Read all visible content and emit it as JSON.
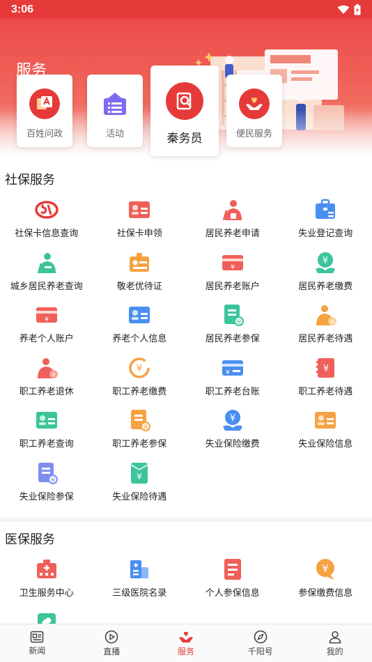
{
  "status": {
    "time": "3:06"
  },
  "header": {
    "title": "服务"
  },
  "quick_links": [
    {
      "label": "百姓问政",
      "icon": "petition-icon"
    },
    {
      "label": "活动",
      "icon": "activity-icon"
    },
    {
      "label": "秦务员",
      "icon": "search-doc-icon"
    },
    {
      "label": "便民服务",
      "icon": "heart-hands-icon"
    }
  ],
  "social": {
    "title": "社保服务",
    "items": [
      {
        "label": "社保卡信息查询",
        "icon": "social-security-logo-icon"
      },
      {
        "label": "社保卡申领",
        "icon": "id-card-icon"
      },
      {
        "label": "居民养老申请",
        "icon": "elderly-person-icon"
      },
      {
        "label": "失业登记查询",
        "icon": "briefcase-icon"
      },
      {
        "label": "城乡居民养老查询",
        "icon": "elderly-cane-icon"
      },
      {
        "label": "敬老优待证",
        "icon": "certificate-icon"
      },
      {
        "label": "居民养老账户",
        "icon": "bank-card-icon"
      },
      {
        "label": "居民养老缴费",
        "icon": "coin-hand-icon"
      },
      {
        "label": "养老个人账户",
        "icon": "card-account-icon"
      },
      {
        "label": "养老个人信息",
        "icon": "profile-card-icon"
      },
      {
        "label": "居民养老参保",
        "icon": "insurance-doc-icon"
      },
      {
        "label": "居民养老待遇",
        "icon": "elderly-benefit-icon"
      },
      {
        "label": "职工养老退休",
        "icon": "retire-person-icon"
      },
      {
        "label": "职工养老缴费",
        "icon": "yuan-refresh-icon"
      },
      {
        "label": "职工养老台账",
        "icon": "ledger-card-icon"
      },
      {
        "label": "职工养老待遇",
        "icon": "benefit-book-icon"
      },
      {
        "label": "职工养老查询",
        "icon": "staff-card-icon"
      },
      {
        "label": "职工养老参保",
        "icon": "staff-insure-doc-icon"
      },
      {
        "label": "失业保险缴费",
        "icon": "yuan-hand-icon"
      },
      {
        "label": "失业保险信息",
        "icon": "info-card-icon"
      },
      {
        "label": "失业保险参保",
        "icon": "unemploy-insure-doc-icon"
      },
      {
        "label": "失业保险待遇",
        "icon": "yuan-envelope-icon"
      }
    ]
  },
  "medical": {
    "title": "医保服务",
    "items": [
      {
        "label": "卫生服务中心",
        "icon": "clinic-icon"
      },
      {
        "label": "三级医院名录",
        "icon": "hospital-icon"
      },
      {
        "label": "个人参保信息",
        "icon": "document-icon"
      },
      {
        "label": "参保缴费信息",
        "icon": "yuan-bubble-icon"
      },
      {
        "label": "",
        "icon": "medicine-icon"
      }
    ]
  },
  "tabs": [
    {
      "label": "新闻",
      "icon": "news-icon"
    },
    {
      "label": "直播",
      "icon": "live-play-icon"
    },
    {
      "label": "服务",
      "icon": "service-heart-icon",
      "active": true
    },
    {
      "label": "千阳号",
      "icon": "compass-icon"
    },
    {
      "label": "我的",
      "icon": "user-icon"
    }
  ],
  "colors": {
    "brand": "#e63a3a",
    "orange": "#f5a242",
    "blue": "#4a8ef0",
    "green": "#3cc49a",
    "purple": "#7e6cf0"
  }
}
